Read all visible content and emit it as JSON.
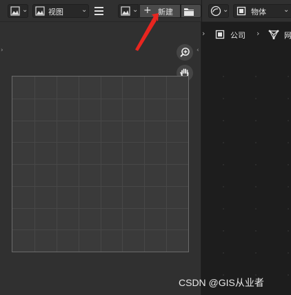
{
  "left_header": {
    "editor_type_icon": "image-editor-icon",
    "view_menu_icon": "image-icon",
    "view_menu_label": "视图",
    "hamburger_icon": "menu-icon",
    "image_browse_icon": "image-icon",
    "new_button": {
      "icon": "plus-icon",
      "label": "新建"
    },
    "open_button_icon": "folder-icon"
  },
  "right_header": {
    "shading_icon": "sphere-icon",
    "mode_icon": "object-icon",
    "mode_label": "物体"
  },
  "breadcrumb": {
    "items": [
      {
        "icon": "collection-icon",
        "label": "公司"
      },
      {
        "icon": "mesh-icon",
        "label": "网"
      }
    ]
  },
  "tools": {
    "zoom_icon": "zoom-in-icon",
    "pan_icon": "hand-icon"
  },
  "grid": {
    "columns": 8,
    "rows": 8
  },
  "annotation": {
    "color": "#e8251f"
  },
  "watermark": "CSDN @GIS从业者",
  "colors": {
    "panel_bg": "#303030",
    "viewport_bg": "#1d1d1d",
    "grid_bg": "#3a3a3a"
  }
}
